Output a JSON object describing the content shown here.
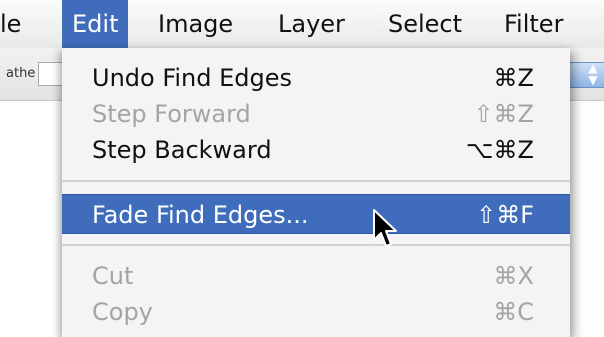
{
  "menubar": {
    "items": [
      {
        "label": "le"
      },
      {
        "label": "Edit"
      },
      {
        "label": "Image"
      },
      {
        "label": "Layer"
      },
      {
        "label": "Select"
      },
      {
        "label": "Filter"
      }
    ]
  },
  "optionsbar": {
    "feather_label": "athe"
  },
  "edit_menu": {
    "items": [
      {
        "label": "Undo Find Edges",
        "shortcut": "⌘Z",
        "enabled": true
      },
      {
        "label": "Step Forward",
        "shortcut": "⇧⌘Z",
        "enabled": false
      },
      {
        "label": "Step Backward",
        "shortcut": "⌥⌘Z",
        "enabled": true
      },
      {
        "label": "Fade Find Edges...",
        "shortcut": "⇧⌘F",
        "enabled": true,
        "highlighted": true
      },
      {
        "label": "Cut",
        "shortcut": "⌘X",
        "enabled": false
      },
      {
        "label": "Copy",
        "shortcut": "⌘C",
        "enabled": false
      }
    ]
  },
  "colors": {
    "highlight": "#3f6dbb",
    "disabled_text": "#a4a4a4",
    "menu_background": "#f4f4f4"
  },
  "icons": {
    "cursor": "arrow-pointer-icon",
    "select_arrows": "up-down-arrows-icon"
  }
}
